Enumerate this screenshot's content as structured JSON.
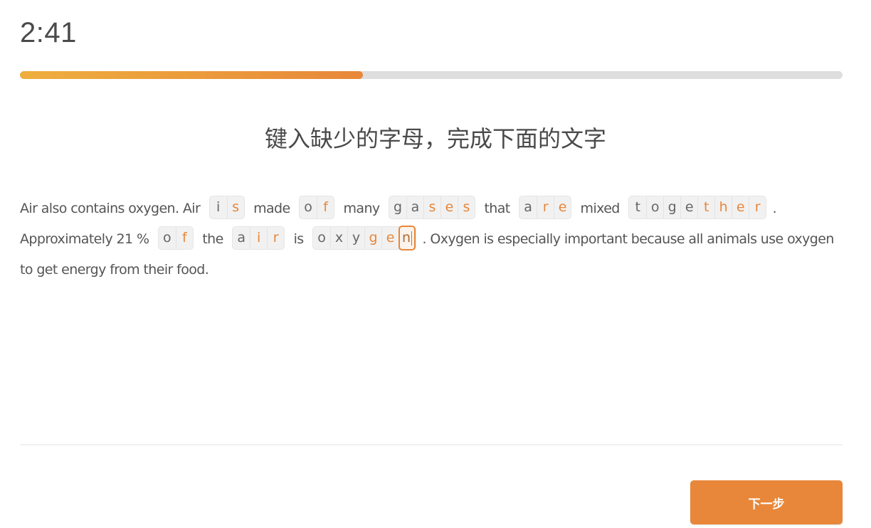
{
  "timer": {
    "value": "2:41"
  },
  "progress": {
    "percent": 41.7,
    "fill_color_start": "#eeae3e",
    "fill_color_end": "#e8883a",
    "track_color": "#dedede"
  },
  "instruction": {
    "title": "键入缺少的字母，完成下面的文字"
  },
  "colors": {
    "accent": "#e8873a",
    "text": "#555555"
  },
  "passage": {
    "segments": [
      {
        "type": "text",
        "text": "Air also contains oxygen. Air"
      },
      {
        "type": "word",
        "letters": [
          {
            "ch": "i",
            "state": "given"
          },
          {
            "ch": "s",
            "state": "typed"
          }
        ]
      },
      {
        "type": "text",
        "text": "made"
      },
      {
        "type": "word",
        "letters": [
          {
            "ch": "o",
            "state": "given"
          },
          {
            "ch": "f",
            "state": "typed"
          }
        ]
      },
      {
        "type": "text",
        "text": "many"
      },
      {
        "type": "word",
        "letters": [
          {
            "ch": "g",
            "state": "given"
          },
          {
            "ch": "a",
            "state": "given"
          },
          {
            "ch": "s",
            "state": "typed"
          },
          {
            "ch": "e",
            "state": "typed"
          },
          {
            "ch": "s",
            "state": "typed"
          }
        ]
      },
      {
        "type": "text",
        "text": "that"
      },
      {
        "type": "word",
        "letters": [
          {
            "ch": "a",
            "state": "given"
          },
          {
            "ch": "r",
            "state": "typed"
          },
          {
            "ch": "e",
            "state": "typed"
          }
        ]
      },
      {
        "type": "text",
        "text": "mixed"
      },
      {
        "type": "word",
        "letters": [
          {
            "ch": "t",
            "state": "given"
          },
          {
            "ch": "o",
            "state": "given"
          },
          {
            "ch": "g",
            "state": "given"
          },
          {
            "ch": "e",
            "state": "given"
          },
          {
            "ch": "t",
            "state": "typed"
          },
          {
            "ch": "h",
            "state": "typed"
          },
          {
            "ch": "e",
            "state": "typed"
          },
          {
            "ch": "r",
            "state": "typed"
          }
        ]
      },
      {
        "type": "punct",
        "text": "."
      },
      {
        "type": "text",
        "text": "Approximately 21 %"
      },
      {
        "type": "word",
        "letters": [
          {
            "ch": "o",
            "state": "given"
          },
          {
            "ch": "f",
            "state": "typed"
          }
        ]
      },
      {
        "type": "text",
        "text": "the"
      },
      {
        "type": "word",
        "letters": [
          {
            "ch": "a",
            "state": "given"
          },
          {
            "ch": "i",
            "state": "typed"
          },
          {
            "ch": "r",
            "state": "typed"
          }
        ]
      },
      {
        "type": "text",
        "text": "is"
      },
      {
        "type": "word",
        "letters": [
          {
            "ch": "o",
            "state": "given"
          },
          {
            "ch": "x",
            "state": "given"
          },
          {
            "ch": "y",
            "state": "given"
          },
          {
            "ch": "g",
            "state": "typed"
          },
          {
            "ch": "e",
            "state": "typed"
          },
          {
            "ch": "n",
            "state": "active"
          }
        ]
      },
      {
        "type": "punct",
        "text": ". Oxygen is especially important because all animals use oxygen to get energy from their food."
      }
    ]
  },
  "footer": {
    "next_label": "下一步"
  }
}
